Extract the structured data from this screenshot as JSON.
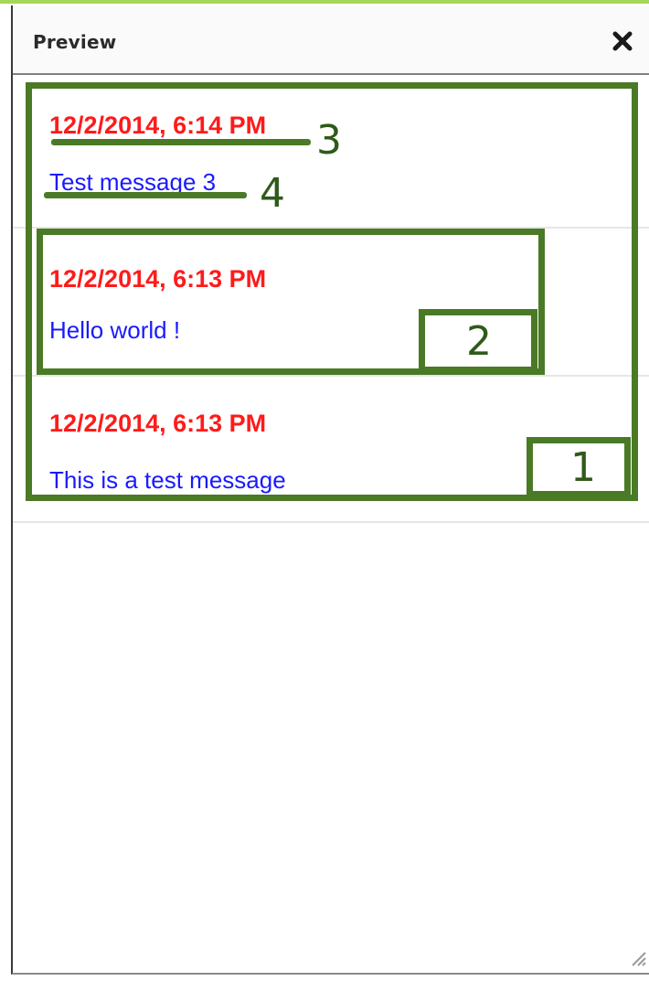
{
  "panel": {
    "title": "Preview",
    "close_icon": "close-icon"
  },
  "messages": [
    {
      "timestamp": "12/2/2014, 6:14 PM",
      "text": "Test message 3",
      "text_is_link": true
    },
    {
      "timestamp": "12/2/2014, 6:13 PM",
      "text": "Hello world !",
      "text_is_link": false
    },
    {
      "timestamp": "12/2/2014, 6:13 PM",
      "text": "This is a test message",
      "text_is_link": false
    }
  ],
  "annotations": {
    "labels": [
      "1",
      "2",
      "3",
      "4"
    ],
    "color": "#4a7a26"
  },
  "colors": {
    "timestamp": "#ff1a1a",
    "message_text": "#1a1aff",
    "accent_top": "#a6d65a"
  }
}
